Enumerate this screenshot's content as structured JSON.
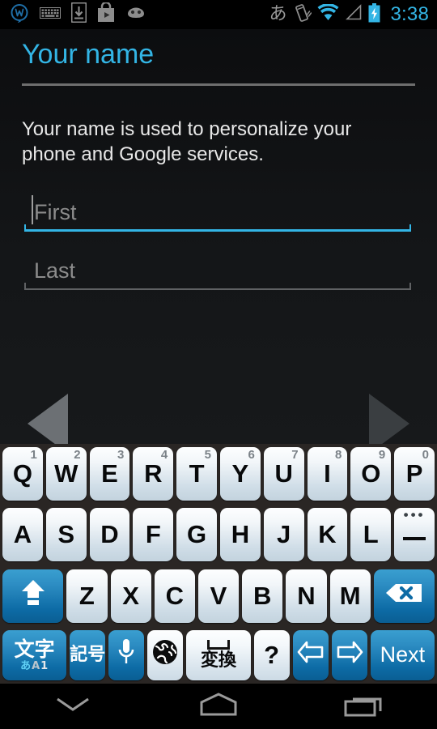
{
  "status_bar": {
    "left_icons": [
      {
        "name": "wordpress-logo-icon",
        "label": "W"
      },
      {
        "name": "keyboard-icon",
        "label": "keyboard"
      },
      {
        "name": "download-to-device-icon",
        "label": "download"
      },
      {
        "name": "play-store-icon",
        "label": "play store"
      },
      {
        "name": "android-face-icon",
        "label": "android"
      }
    ],
    "ime_indicator": "あ",
    "right_icons": [
      {
        "name": "vibrate-icon",
        "label": "vibrate"
      },
      {
        "name": "wifi-icon",
        "label": "wifi"
      },
      {
        "name": "signal-icon",
        "label": "signal"
      },
      {
        "name": "battery-charging-icon",
        "label": "battery charging"
      }
    ],
    "clock": "3:38",
    "clock_color": "#33b5e5"
  },
  "setup": {
    "title": "Your name",
    "description": "Your name is used to personalize your phone and Google services.",
    "fields": [
      {
        "name": "first-name-input",
        "placeholder": "First",
        "value": "",
        "focused": true
      },
      {
        "name": "last-name-input",
        "placeholder": "Last",
        "value": "",
        "focused": false
      }
    ],
    "nav": {
      "prev_label": "Back",
      "prev_enabled": true,
      "next_label": "Next",
      "next_enabled": false
    },
    "accent_color": "#33b5e5"
  },
  "keyboard": {
    "rows": [
      {
        "id": "row-qwerty",
        "keys": [
          {
            "label": "Q",
            "hint": "1",
            "name": "key-q"
          },
          {
            "label": "W",
            "hint": "2",
            "name": "key-w"
          },
          {
            "label": "E",
            "hint": "3",
            "name": "key-e"
          },
          {
            "label": "R",
            "hint": "4",
            "name": "key-r"
          },
          {
            "label": "T",
            "hint": "5",
            "name": "key-t"
          },
          {
            "label": "Y",
            "hint": "6",
            "name": "key-y"
          },
          {
            "label": "U",
            "hint": "7",
            "name": "key-u"
          },
          {
            "label": "I",
            "hint": "8",
            "name": "key-i"
          },
          {
            "label": "O",
            "hint": "9",
            "name": "key-o"
          },
          {
            "label": "P",
            "hint": "0",
            "name": "key-p"
          }
        ]
      },
      {
        "id": "row-asdf",
        "keys": [
          {
            "label": "A",
            "name": "key-a"
          },
          {
            "label": "S",
            "name": "key-s"
          },
          {
            "label": "D",
            "name": "key-d"
          },
          {
            "label": "F",
            "name": "key-f"
          },
          {
            "label": "G",
            "name": "key-g"
          },
          {
            "label": "H",
            "name": "key-h"
          },
          {
            "label": "J",
            "name": "key-j"
          },
          {
            "label": "K",
            "name": "key-k"
          },
          {
            "label": "L",
            "name": "key-l"
          },
          {
            "label": "—",
            "hint": "...",
            "name": "key-dash"
          }
        ]
      },
      {
        "id": "row-zxcv",
        "keys": [
          {
            "label": "",
            "name": "key-shift",
            "icon": "shift-arrow-icon",
            "style": "blue",
            "width": "wide"
          },
          {
            "label": "Z",
            "name": "key-z"
          },
          {
            "label": "X",
            "name": "key-x"
          },
          {
            "label": "C",
            "name": "key-c"
          },
          {
            "label": "V",
            "name": "key-v"
          },
          {
            "label": "B",
            "name": "key-b"
          },
          {
            "label": "N",
            "name": "key-n"
          },
          {
            "label": "M",
            "name": "key-m"
          },
          {
            "label": "",
            "name": "key-backspace",
            "icon": "backspace-icon",
            "style": "blue",
            "width": "wide"
          }
        ]
      },
      {
        "id": "row-bottom",
        "keys": [
          {
            "label": "文字",
            "sublabel": "あA1",
            "name": "key-mode-switch",
            "style": "blue",
            "width": "wide"
          },
          {
            "label": "記号",
            "name": "key-symbols",
            "style": "blue"
          },
          {
            "label": "",
            "name": "key-voice-input",
            "icon": "microphone-icon",
            "style": "blue"
          },
          {
            "label": "",
            "name": "key-language-switch",
            "icon": "globe-icon",
            "style": "white"
          },
          {
            "label": "変換",
            "name": "key-convert-space",
            "icon": "spacebar-icon",
            "style": "white",
            "width": "wide"
          },
          {
            "label": "?",
            "name": "key-question-mark",
            "style": "white"
          },
          {
            "label": "",
            "name": "key-arrow-left",
            "icon": "arrow-left-icon",
            "style": "blue"
          },
          {
            "label": "",
            "name": "key-arrow-right",
            "icon": "arrow-right-icon",
            "style": "blue"
          },
          {
            "label": "Next",
            "name": "key-next-action",
            "style": "blue",
            "width": "wide"
          }
        ]
      }
    ]
  },
  "nav_bar": {
    "buttons": [
      {
        "name": "hide-keyboard-button",
        "label": "Hide keyboard",
        "icon": "chevron-down-icon"
      },
      {
        "name": "home-button",
        "label": "Home",
        "icon": "home-icon"
      },
      {
        "name": "recents-button",
        "label": "Recent apps",
        "icon": "recents-icon"
      }
    ]
  }
}
